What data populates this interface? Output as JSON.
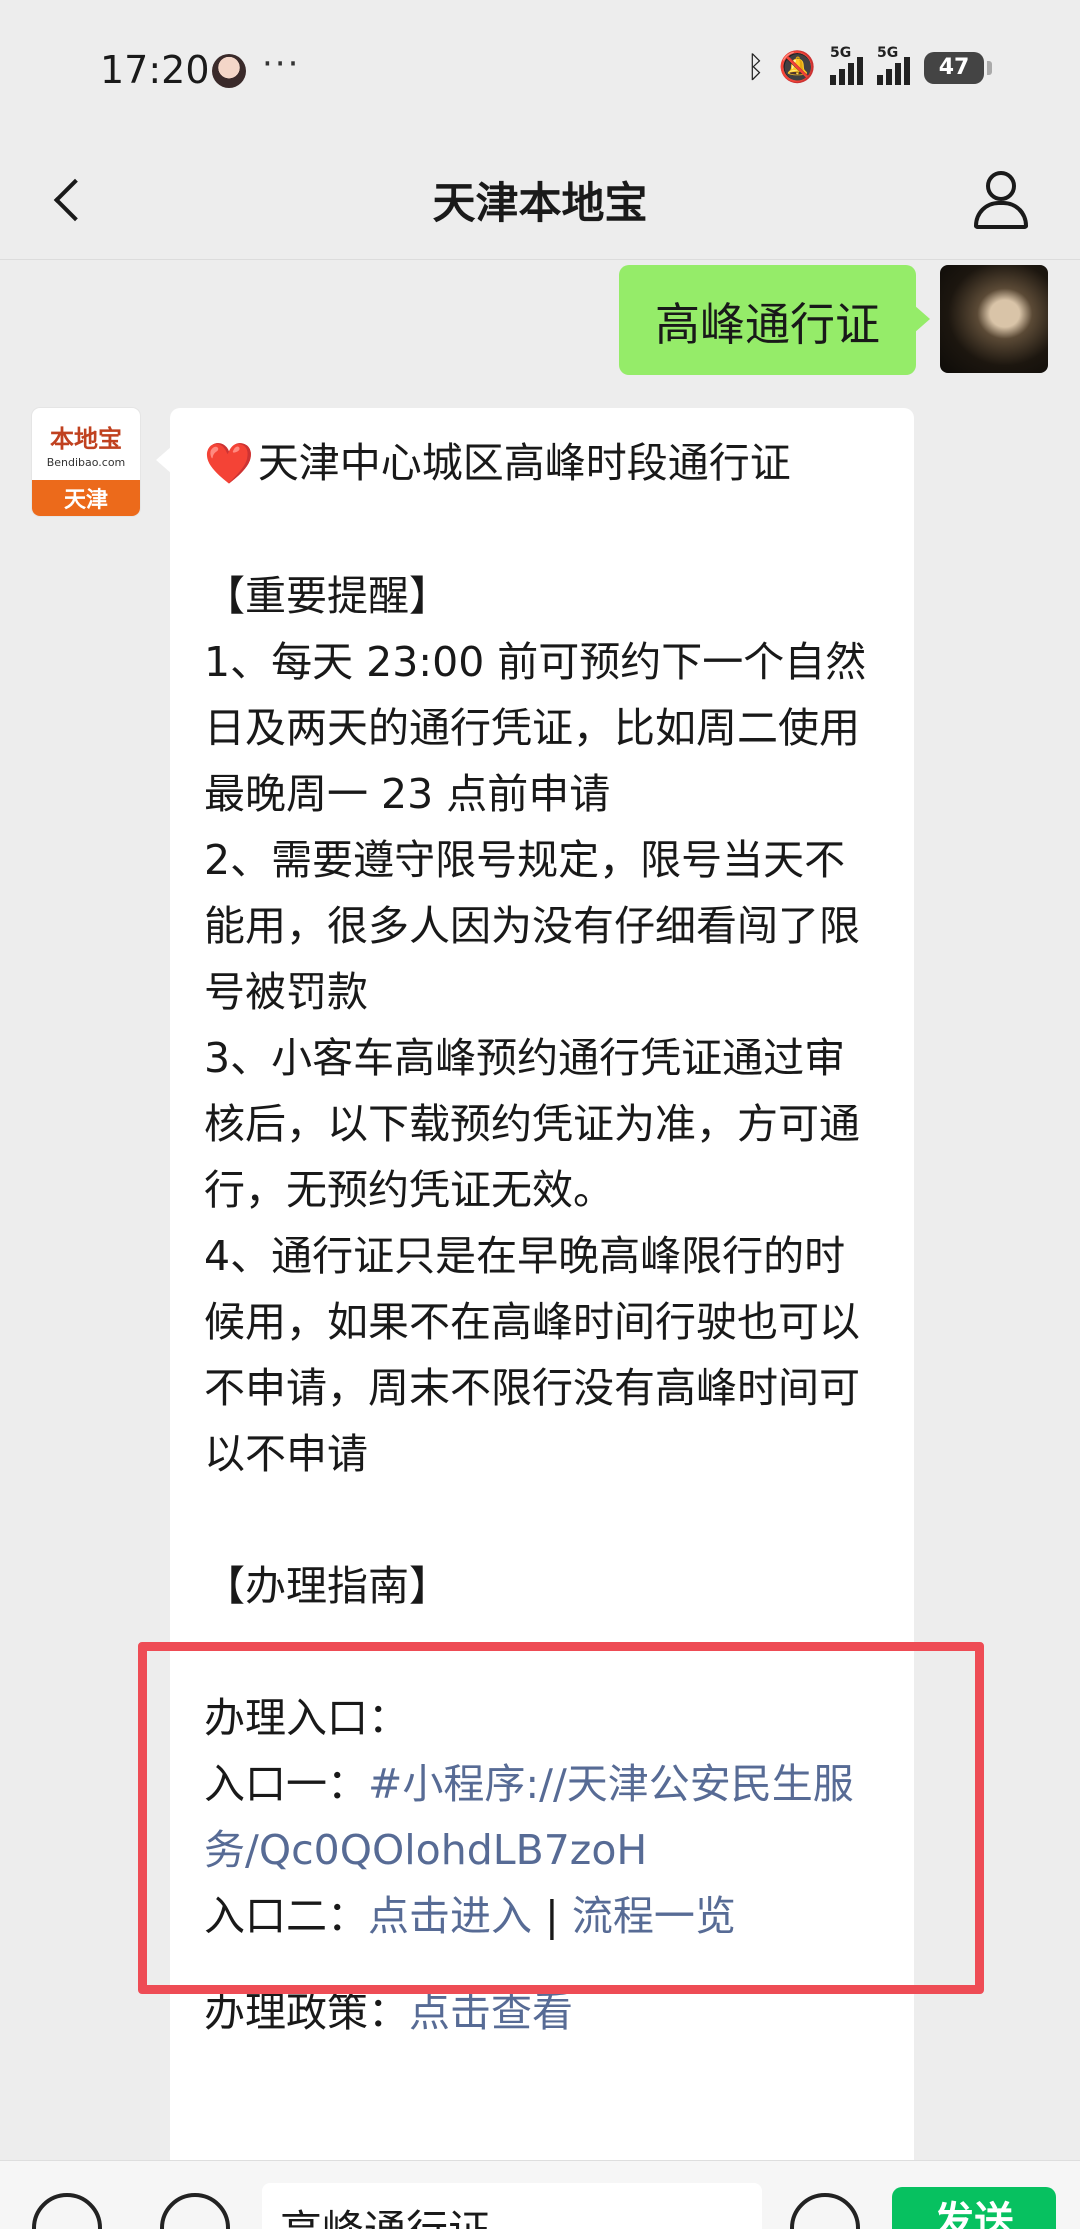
{
  "status_bar": {
    "time": "17:20",
    "more": "···",
    "bluetooth_icon": "bluetooth-icon",
    "mute_icon": "bell-off-icon",
    "signal1_label": "5G",
    "signal2_label": "5G",
    "battery": "47"
  },
  "nav": {
    "title": "天津本地宝"
  },
  "user_message": {
    "text": "高峰通行证"
  },
  "bot_avatar": {
    "brand": "本地宝",
    "domain": "Bendibao.com",
    "city": "天津"
  },
  "bot_message": {
    "heart": "❤️",
    "title": "天津中心城区高峰时段通行证",
    "reminder_heading": "【重要提醒】",
    "items": [
      "1、每天 23:00 前可预约下一个自然日及两天的通行凭证，比如周二使用最晚周一 23 点前申请",
      "2、需要遵守限号规定，限号当天不能用，很多人因为没有仔细看闯了限号被罚款",
      "3、小客车高峰预约通行凭证通过审核后，以下载预约凭证为准，方可通行，无预约凭证无效。",
      "4、通行证只是在早晚高峰限行的时候用，如果不在高峰时间行驶也可以不申请，周末不限行没有高峰时间可以不申请"
    ],
    "guide_heading": "【办理指南】",
    "entry_label": "办理入口：",
    "entry1_label": "入口一：",
    "entry1_link": "#小程序://天津公安民生服务/Qc0QOlohdLB7zoH",
    "entry2_label": "入口二：",
    "entry2_link_a": "点击进入",
    "entry2_sep": " | ",
    "entry2_link_b": "流程一览",
    "policy_label": "办理政策：",
    "policy_link": "点击查看"
  },
  "input_bar": {
    "draft": "高峰通行证",
    "send_label": "发送"
  },
  "colors": {
    "user_bubble": "#95ec69",
    "link": "#576b95",
    "highlight": "#ee4c55",
    "send_button": "#07c160"
  }
}
